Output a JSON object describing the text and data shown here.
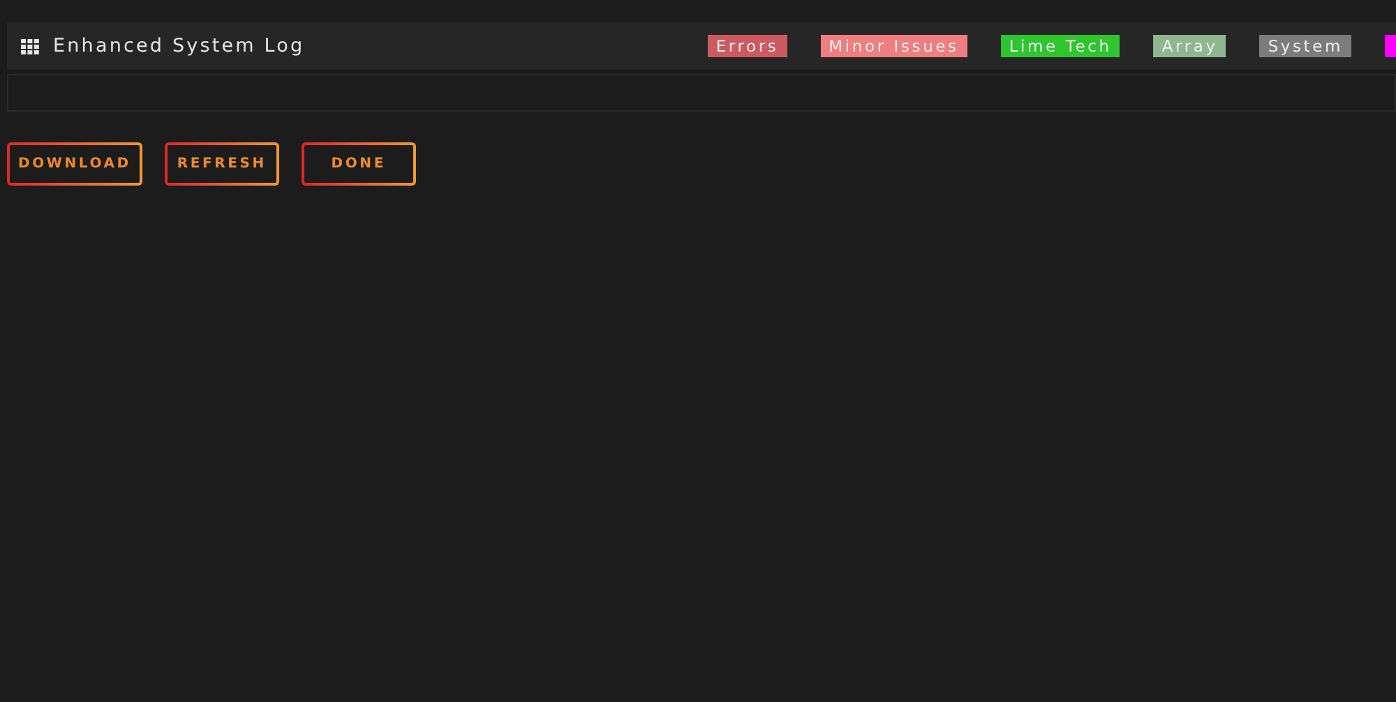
{
  "header": {
    "title": "Enhanced System Log"
  },
  "legend": [
    {
      "label": "Errors",
      "color": "#cc5a5e"
    },
    {
      "label": "Minor Issues",
      "color": "#f07e80"
    },
    {
      "label": "Lime Tech",
      "color": "#2ec52e"
    },
    {
      "label": "Array",
      "color": "#8fb78f"
    },
    {
      "label": "System",
      "color": "#7c7c7c"
    },
    {
      "color": "#ff00ff"
    }
  ],
  "buttons": [
    "DOWNLOAD",
    "REFRESH",
    "DONE"
  ]
}
